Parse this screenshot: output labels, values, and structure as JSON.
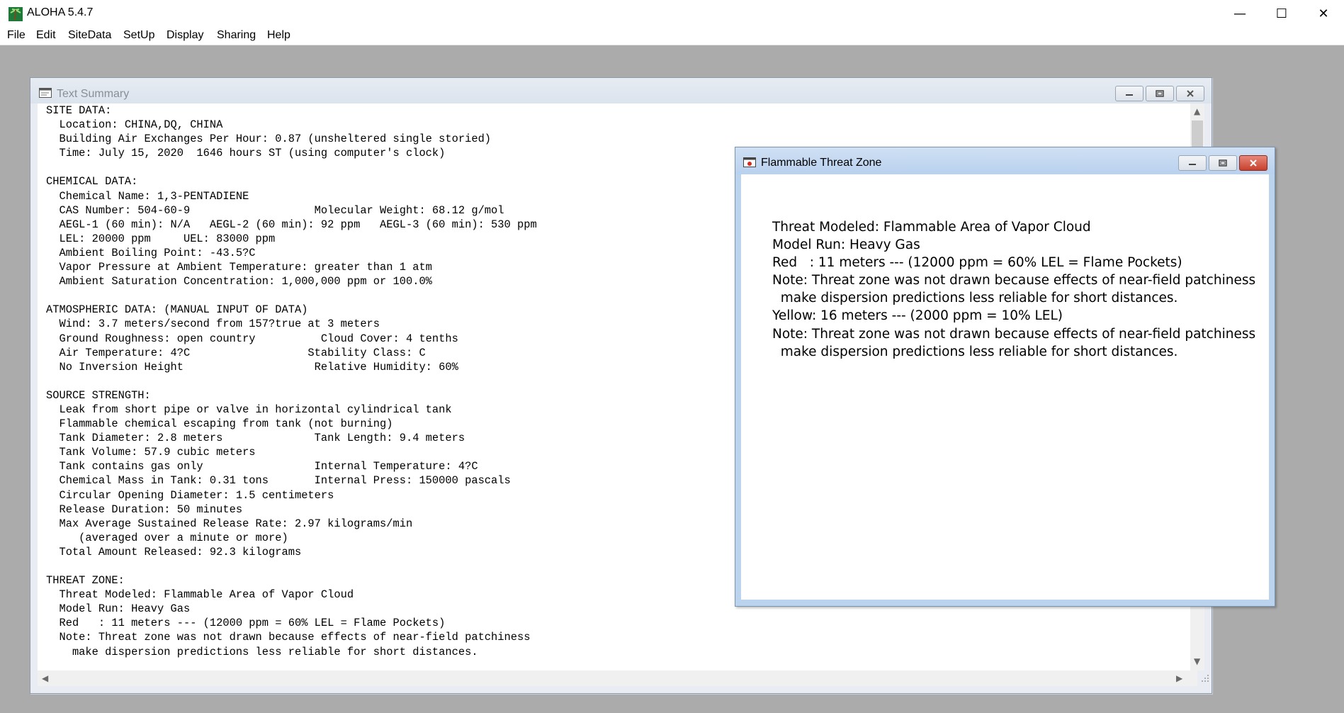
{
  "app": {
    "title": "ALOHA 5.4.7",
    "minimize": "—",
    "maximize": "☐",
    "close": "✕"
  },
  "menu": [
    "File",
    "Edit",
    "SiteData",
    "SetUp",
    "Display",
    "Sharing",
    "Help"
  ],
  "text_summary": {
    "title": "Text Summary",
    "lines": [
      "SITE DATA:",
      "  Location: CHINA,DQ, CHINA",
      "  Building Air Exchanges Per Hour: 0.87 (unsheltered single storied)",
      "  Time: July 15, 2020  1646 hours ST (using computer's clock)",
      "",
      "CHEMICAL DATA:",
      "  Chemical Name: 1,3-PENTADIENE",
      "  CAS Number: 504-60-9                   Molecular Weight: 68.12 g/mol",
      "  AEGL-1 (60 min): N/A   AEGL-2 (60 min): 92 ppm   AEGL-3 (60 min): 530 ppm",
      "  LEL: 20000 ppm     UEL: 83000 ppm",
      "  Ambient Boiling Point: -43.5?C",
      "  Vapor Pressure at Ambient Temperature: greater than 1 atm",
      "  Ambient Saturation Concentration: 1,000,000 ppm or 100.0%",
      "",
      "ATMOSPHERIC DATA: (MANUAL INPUT OF DATA)",
      "  Wind: 3.7 meters/second from 157?true at 3 meters",
      "  Ground Roughness: open country          Cloud Cover: 4 tenths",
      "  Air Temperature: 4?C                  Stability Class: C",
      "  No Inversion Height                    Relative Humidity: 60%",
      "",
      "SOURCE STRENGTH:",
      "  Leak from short pipe or valve in horizontal cylindrical tank",
      "  Flammable chemical escaping from tank (not burning)",
      "  Tank Diameter: 2.8 meters              Tank Length: 9.4 meters",
      "  Tank Volume: 57.9 cubic meters",
      "  Tank contains gas only                 Internal Temperature: 4?C",
      "  Chemical Mass in Tank: 0.31 tons       Internal Press: 150000 pascals",
      "  Circular Opening Diameter: 1.5 centimeters",
      "  Release Duration: 50 minutes",
      "  Max Average Sustained Release Rate: 2.97 kilograms/min",
      "     (averaged over a minute or more)",
      "  Total Amount Released: 92.3 kilograms",
      "",
      "THREAT ZONE:",
      "  Threat Modeled: Flammable Area of Vapor Cloud",
      "  Model Run: Heavy Gas",
      "  Red   : 11 meters --- (12000 ppm = 60% LEL = Flame Pockets)",
      "  Note: Threat zone was not drawn because effects of near-field patchiness",
      "    make dispersion predictions less reliable for short distances."
    ]
  },
  "threat_zone_window": {
    "title": "Flammable Threat Zone",
    "lines": [
      "Threat Modeled: Flammable Area of Vapor Cloud",
      "Model Run: Heavy Gas",
      "Red   : 11 meters --- (12000 ppm = 60% LEL = Flame Pockets)",
      "Note: Threat zone was not drawn because effects of near-field patchiness",
      "  make dispersion predictions less reliable for short distances.",
      "Yellow: 16 meters --- (2000 ppm = 10% LEL)",
      "Note: Threat zone was not drawn because effects of near-field patchiness",
      "  make dispersion predictions less reliable for short distances."
    ]
  },
  "colors": {
    "desktop": "#ababab",
    "mdi_title_inactive": "#dbe3ed",
    "mdi_title_active": "#b9d1ee",
    "close_red": "#c7402d"
  }
}
